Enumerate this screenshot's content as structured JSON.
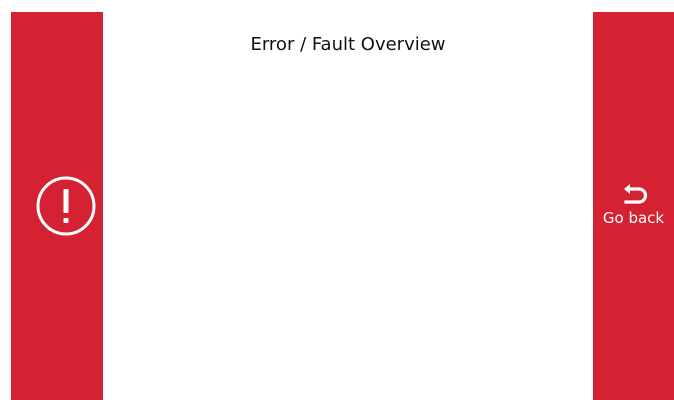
{
  "header": {
    "title": "Error / Fault Overview"
  },
  "left_panel": {
    "icon": "exclamation-circle-icon",
    "color": "#d42232"
  },
  "right_panel": {
    "back_label": "Go back",
    "icon": "undo-arrow-icon",
    "color": "#d42232"
  },
  "colors": {
    "accent": "#d42232",
    "background": "#ffffff",
    "text": "#111111"
  }
}
